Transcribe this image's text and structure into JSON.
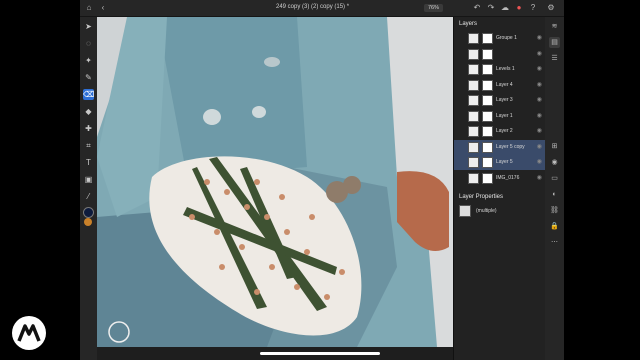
{
  "document": {
    "title": "249 copy (3) (2) copy (15) *",
    "zoom": "76%"
  },
  "toolbar": {
    "tools": [
      {
        "name": "move-tool",
        "icon": "arrow-pointer-icon"
      },
      {
        "name": "select-tool",
        "icon": "lasso-icon"
      },
      {
        "name": "quick-select-tool",
        "icon": "magic-lasso-icon"
      },
      {
        "name": "brush-tool",
        "icon": "brush-icon"
      },
      {
        "name": "eraser-tool",
        "icon": "eraser-icon"
      },
      {
        "name": "fill-tool",
        "icon": "paint-bucket-icon"
      },
      {
        "name": "healing-tool",
        "icon": "bandage-icon"
      },
      {
        "name": "crop-tool",
        "icon": "crop-icon"
      },
      {
        "name": "type-tool",
        "icon": "type-icon"
      },
      {
        "name": "shape-tool",
        "icon": "image-icon"
      },
      {
        "name": "eyedropper-tool",
        "icon": "eyedropper-icon"
      }
    ],
    "colors": {
      "foreground": "#0d1b3d",
      "background": "#c9812a"
    },
    "sub_values": {
      "size": "31"
    }
  },
  "layers_panel": {
    "title": "Layers",
    "layers": [
      {
        "name": "Groupe 1",
        "selected": false,
        "group": true
      },
      {
        "name": "",
        "selected": false,
        "group": false
      },
      {
        "name": "Levels 1",
        "selected": false,
        "group": false
      },
      {
        "name": "Layer 4",
        "selected": false,
        "group": false
      },
      {
        "name": "Layer 3",
        "selected": false,
        "group": false
      },
      {
        "name": "Layer 1",
        "selected": false,
        "group": false
      },
      {
        "name": "Layer 2",
        "selected": false,
        "group": false
      },
      {
        "name": "Layer 5 copy",
        "selected": true,
        "group": false
      },
      {
        "name": "Layer 5",
        "selected": true,
        "group": false
      },
      {
        "name": "IMG_0176",
        "selected": false,
        "group": false
      }
    ]
  },
  "properties_panel": {
    "title": "Layer Properties",
    "value": "(multiple)"
  },
  "theme": {
    "accent": "#2d6fd6",
    "selection": "#3a4b6a"
  }
}
